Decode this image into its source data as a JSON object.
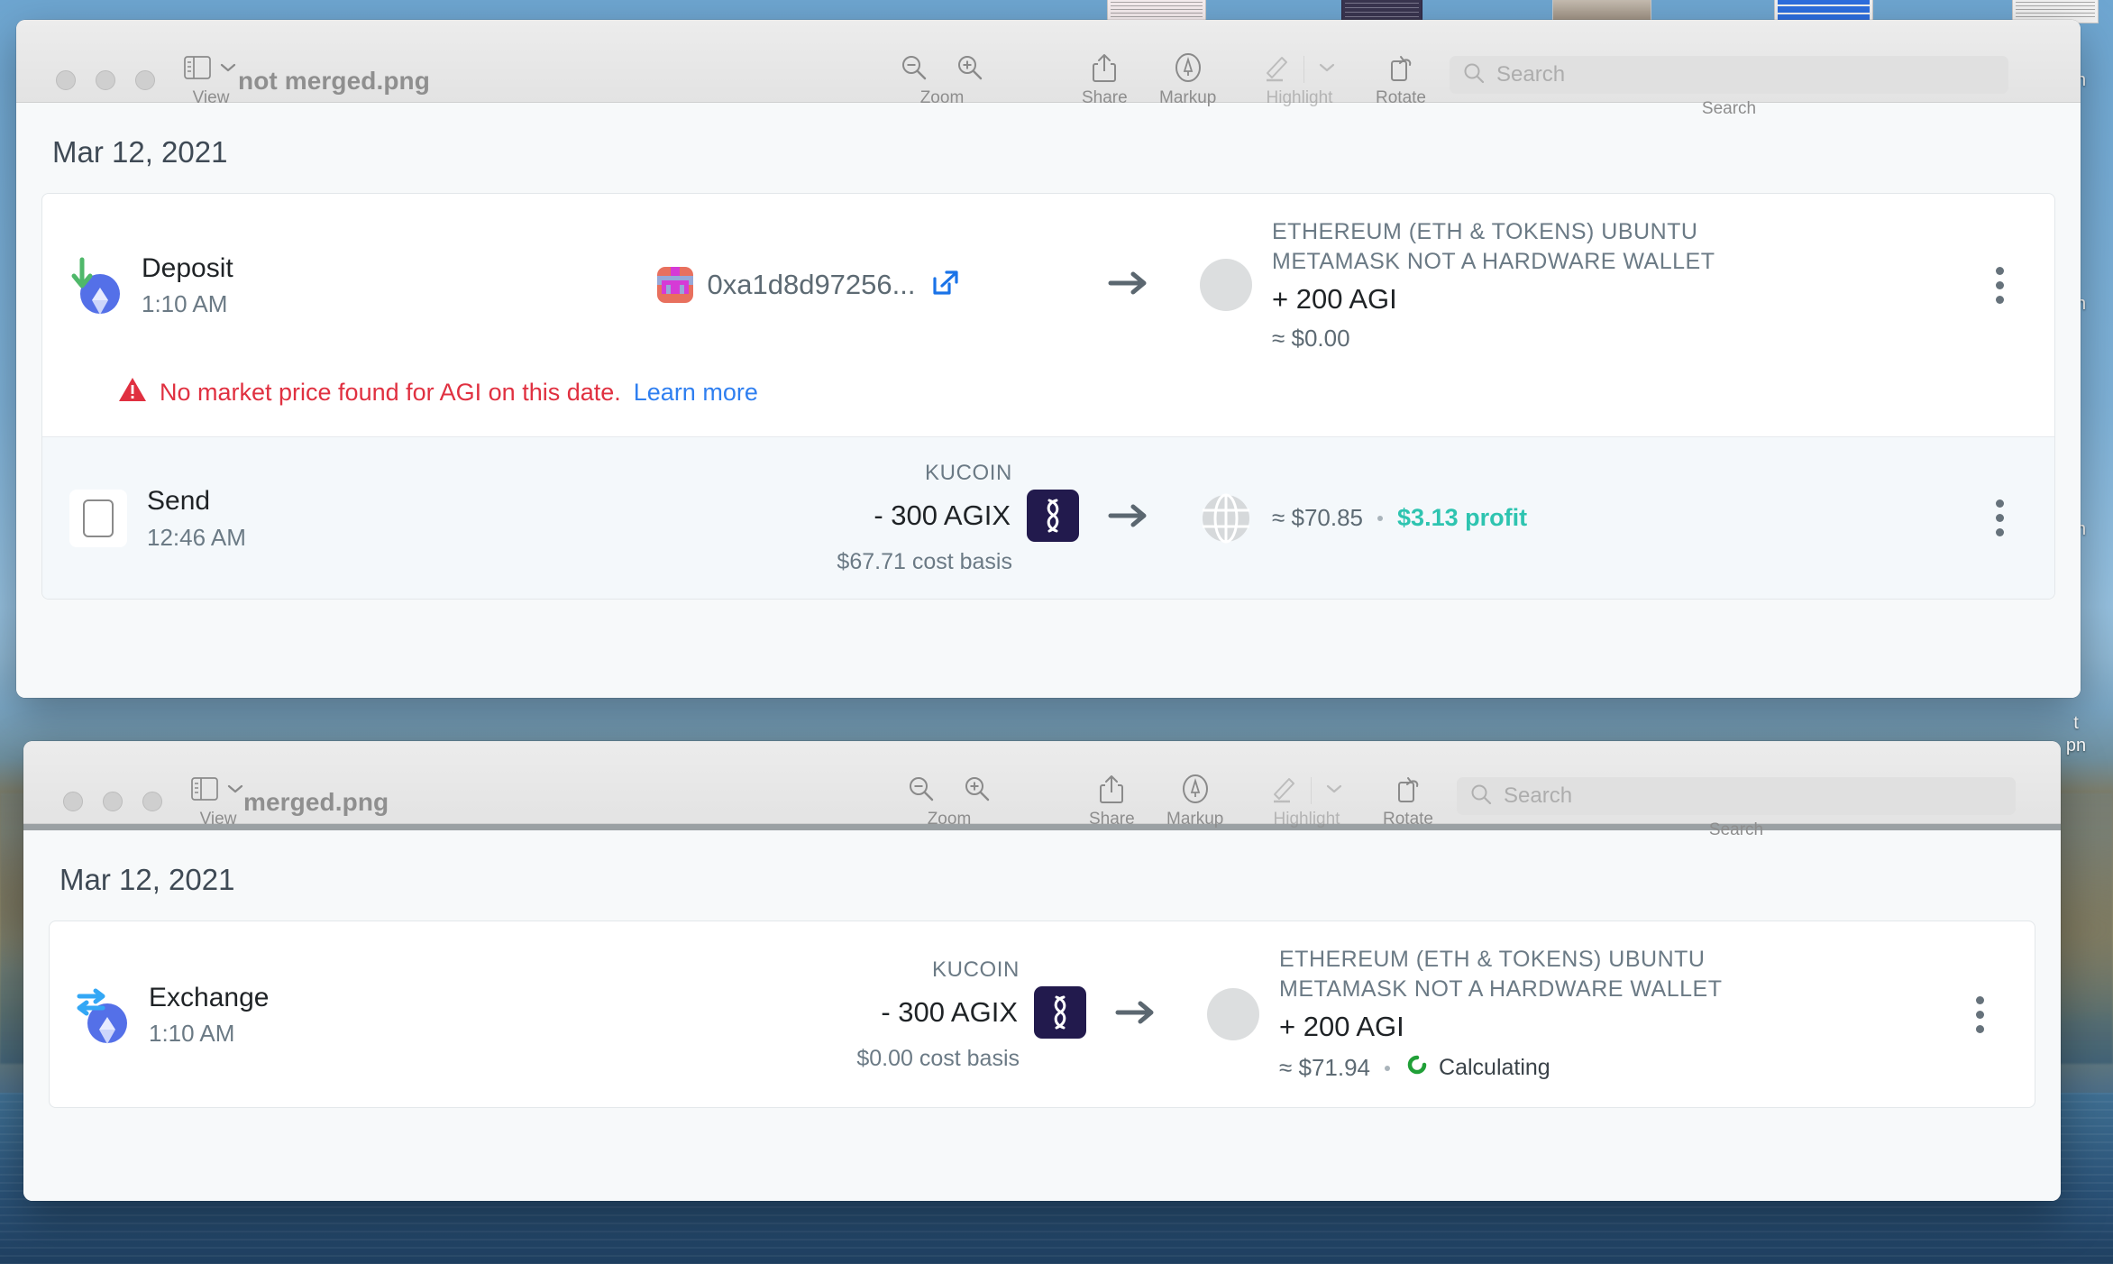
{
  "desktop": {
    "labels": [
      "t\npn",
      "t\npn",
      "t\npn",
      "t\npn"
    ]
  },
  "windows": [
    {
      "id": "not-merged",
      "title": "not merged.png",
      "toolbar": {
        "view_label": "View",
        "zoom_label": "Zoom",
        "share_label": "Share",
        "markup_label": "Markup",
        "highlight_label": "Highlight",
        "rotate_label": "Rotate",
        "search_label": "Search",
        "search_placeholder": "Search",
        "search_value": ""
      },
      "content": {
        "date_header": "Mar 12, 2021",
        "rows": [
          {
            "type": "Deposit",
            "time": "1:10 AM",
            "icon": "eth-deposit-icon",
            "address": "0xa1d8d97256...",
            "wallet_name": "ETHEREUM (ETH & TOKENS) UBUNTU METAMASK NOT A HARDWARE WALLET",
            "gain": "+ 200 AGI",
            "fiat": "≈ $0.00",
            "warning_text": "No market price found for AGI on this date.",
            "warning_link": "Learn more"
          },
          {
            "type": "Send",
            "time": "12:46 AM",
            "icon": "placeholder-image-icon",
            "venue": "KUCOIN",
            "amount": "- 300 AGIX",
            "coin_symbol": "AGIX",
            "cost_basis": "$67.71 cost basis",
            "fiat": "≈ $70.85",
            "profit": "$3.13 profit"
          }
        ]
      }
    },
    {
      "id": "merged",
      "title": "merged.png",
      "toolbar": {
        "view_label": "View",
        "zoom_label": "Zoom",
        "share_label": "Share",
        "markup_label": "Markup",
        "highlight_label": "Highlight",
        "rotate_label": "Rotate",
        "search_label": "Search",
        "search_placeholder": "Search",
        "search_value": ""
      },
      "content": {
        "date_header": "Mar 12, 2021",
        "rows": [
          {
            "type": "Exchange",
            "time": "1:10 AM",
            "icon": "eth-exchange-icon",
            "venue": "KUCOIN",
            "amount": "- 300 AGIX",
            "coin_symbol": "AGIX",
            "cost_basis": "$0.00 cost basis",
            "wallet_name": "ETHEREUM (ETH & TOKENS) UBUNTU METAMASK NOT A HARDWARE WALLET",
            "gain": "+ 200 AGI",
            "fiat": "≈ $71.94",
            "status": "Calculating"
          }
        ]
      }
    }
  ],
  "colors": {
    "profit_teal": "#2ec4b0",
    "warning_red": "#e03040",
    "link_blue": "#2f7ff0",
    "eth_blue": "#5470e8",
    "agix_navy": "#221a4d",
    "calculating_green": "#21a038"
  }
}
